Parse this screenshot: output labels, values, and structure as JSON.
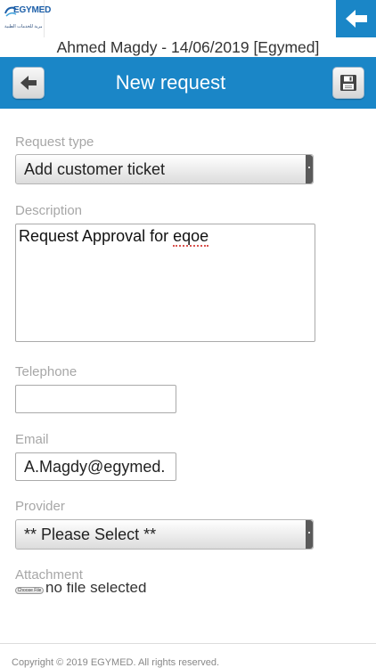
{
  "brand": {
    "logo_text": "EGYMED",
    "logo_subtext": "المصرية للخدمات الطبية",
    "accent_color": "#1a86c7",
    "logo_icon": "egymed-logo-icon"
  },
  "top_bar": {
    "back_icon": "arrow-left-icon"
  },
  "user_line": "Ahmed Magdy - 14/06/2019 [Egymed]",
  "header": {
    "title": "New request",
    "back_icon": "arrow-left-icon",
    "save_icon": "save-disk-icon"
  },
  "form": {
    "request_type": {
      "label": "Request type",
      "value": "Add customer ticket"
    },
    "description": {
      "label": "Description",
      "value_prefix": "Request Approval for ",
      "value_misspelled": "eqoe"
    },
    "telephone": {
      "label": "Telephone",
      "value": ""
    },
    "email": {
      "label": "Email",
      "value": "A.Magdy@egymed."
    },
    "provider": {
      "label": "Provider",
      "value": "** Please Select **"
    },
    "attachment": {
      "label": "Attachment",
      "button_label": "Choose File",
      "status": "no file selected"
    }
  },
  "footer": {
    "copyright": "Copyright © 2019 EGYMED. All rights reserved."
  }
}
